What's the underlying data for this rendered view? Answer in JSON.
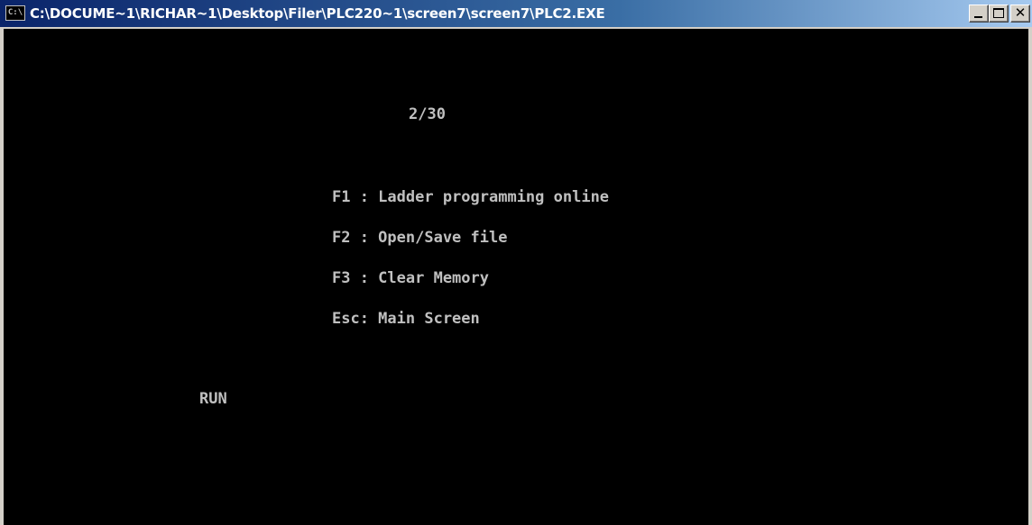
{
  "window": {
    "title": "C:\\DOCUME~1\\RICHAR~1\\Desktop\\Filer\\PLC220~1\\screen7\\screen7\\PLC2.EXE",
    "icon": "cmd-console-icon",
    "icon_text": "C:\\"
  },
  "controls": {
    "minimize": "minimize-icon",
    "maximize": "maximize-icon",
    "close": "close-icon",
    "close_glyph": "✕"
  },
  "console": {
    "page_counter": "2/30",
    "menu": [
      "F1 : Ladder programming online",
      "F2 : Open/Save file",
      "F3 : Clear Memory",
      "Esc: Main Screen"
    ],
    "status": "RUN"
  },
  "colors": {
    "console_bg": "#000000",
    "console_text": "#c0c0c0",
    "titlebar_start": "#0a246a",
    "titlebar_end": "#a6caf0"
  }
}
